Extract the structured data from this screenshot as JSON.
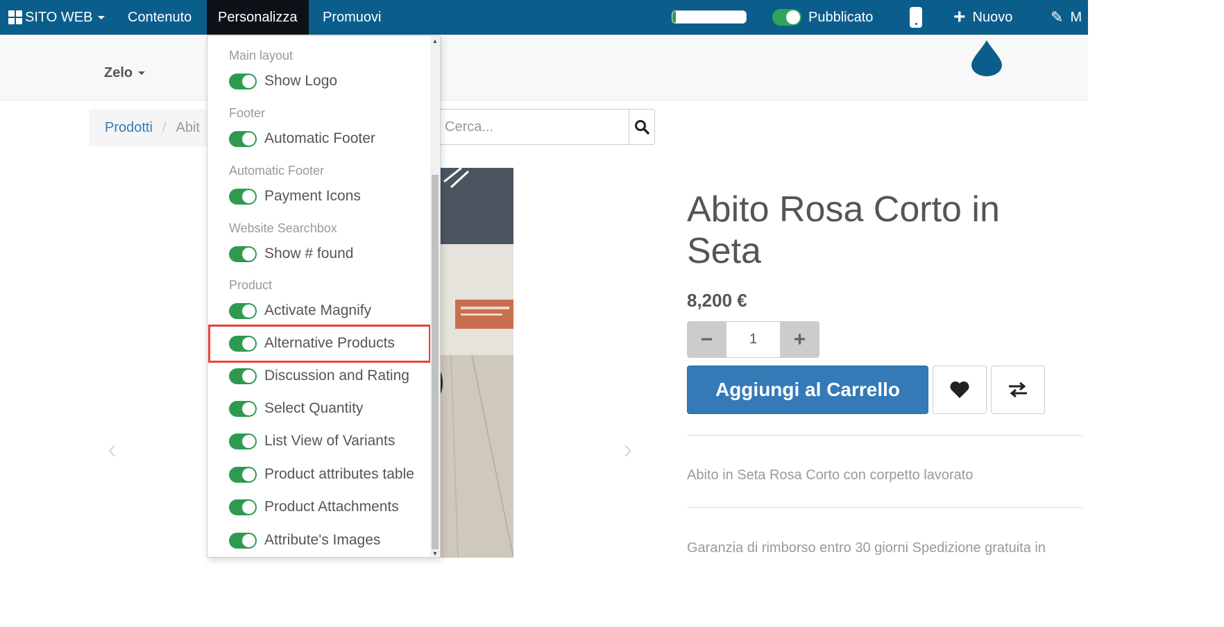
{
  "topbar": {
    "app_menu_label": "SITO WEB",
    "menu_content": "Contenuto",
    "menu_customize": "Personalizza",
    "menu_promote": "Promuovi",
    "published_label": "Pubblicato",
    "new_label": "Nuovo",
    "edit_label": "M",
    "progress_fraction": 0.05
  },
  "subheader": {
    "brand_menu_label": "Zelo"
  },
  "breadcrumb": {
    "root": "Prodotti",
    "separator": "/",
    "current": "Abit"
  },
  "search": {
    "placeholder": "Cerca..."
  },
  "product": {
    "title": "Abito Rosa Corto in Seta",
    "price": "8,200 €",
    "quantity": "1",
    "qty_minus": "−",
    "qty_plus": "+",
    "add_to_cart": "Aggiungi al Carrello",
    "description": "Abito in Seta Rosa Corto con corpetto lavorato",
    "guarantee": "Garanzia di rimborso entro 30 giorni Spedizione gratuita in"
  },
  "customize_menu": {
    "sections": [
      {
        "label": "Main layout",
        "options": [
          {
            "label": "Show Logo"
          }
        ]
      },
      {
        "label": "Footer",
        "options": [
          {
            "label": "Automatic Footer"
          }
        ]
      },
      {
        "label": "Automatic Footer",
        "options": [
          {
            "label": "Payment Icons"
          }
        ]
      },
      {
        "label": "Website Searchbox",
        "options": [
          {
            "label": "Show # found"
          }
        ]
      },
      {
        "label": "Product",
        "options": [
          {
            "label": "Activate Magnify"
          },
          {
            "label": "Alternative Products"
          },
          {
            "label": "Discussion and Rating"
          },
          {
            "label": "Select Quantity"
          },
          {
            "label": "List View of Variants"
          },
          {
            "label": "Product attributes table"
          },
          {
            "label": "Product Attachments"
          },
          {
            "label": "Attribute's Images"
          }
        ]
      }
    ]
  },
  "colors": {
    "topbar": "#0b5e8c",
    "toggle_on": "#2e9a4f",
    "primary_button": "#337ab7",
    "highlight": "#e8413d"
  }
}
